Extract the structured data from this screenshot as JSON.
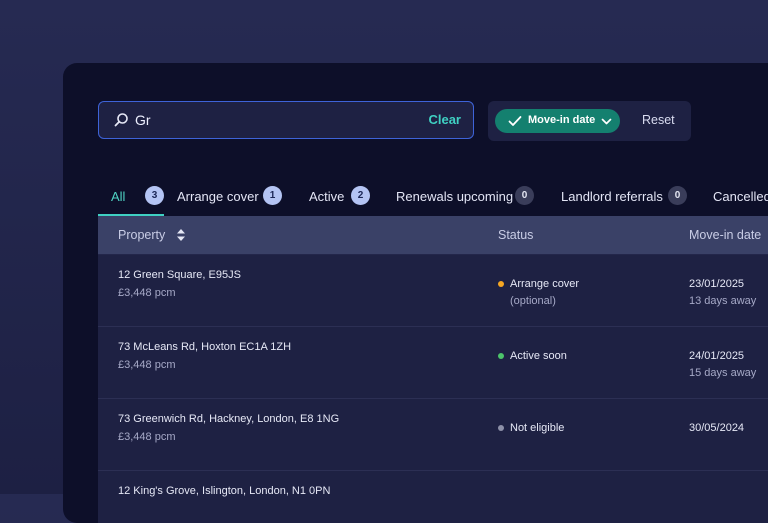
{
  "search": {
    "value": "Gr",
    "clear_label": "Clear"
  },
  "filters": {
    "chip_label": "Move-in date",
    "reset_label": "Reset"
  },
  "tabs": [
    {
      "label": "All",
      "count": "3",
      "active": true
    },
    {
      "label": "Arrange cover",
      "count": "1"
    },
    {
      "label": "Active",
      "count": "2"
    },
    {
      "label": "Renewals upcoming",
      "count": "0"
    },
    {
      "label": "Landlord referrals",
      "count": "0"
    },
    {
      "label": "Cancelled",
      "count": ""
    }
  ],
  "table": {
    "headers": {
      "property": "Property",
      "status": "Status",
      "move_in": "Move-in date"
    },
    "rows": [
      {
        "address": "12 Green Square, E95JS",
        "price": "£3,448 pcm",
        "status": "Arrange cover",
        "status_sub": "(optional)",
        "status_color": "#f5a623",
        "date": "23/01/2025",
        "date_sub": "13 days away"
      },
      {
        "address": "73 McLeans Rd, Hoxton EC1A 1ZH",
        "price": "£3,448 pcm",
        "status": "Active soon",
        "status_sub": "",
        "status_color": "#4cc46a",
        "date": "24/01/2025",
        "date_sub": "15 days away"
      },
      {
        "address": "73 Greenwich Rd, Hackney, London, E8 1NG",
        "price": "£3,448 pcm",
        "status": "Not eligible",
        "status_sub": "",
        "status_color": "#8d90a8",
        "date": "30/05/2024",
        "date_sub": ""
      },
      {
        "address": "12 King's Grove, Islington, London, N1 0PN",
        "price": "",
        "status": "",
        "status_sub": "",
        "status_color": "#8d90a8",
        "date": "",
        "date_sub": ""
      }
    ]
  },
  "colors": {
    "accent": "#3fd0c2",
    "chip": "#14806f",
    "badge_active": "#b4c4f4"
  },
  "icons": {
    "search": "search-icon",
    "check": "check-icon",
    "chevron": "chevron-down-icon",
    "sort": "sort-icon"
  }
}
